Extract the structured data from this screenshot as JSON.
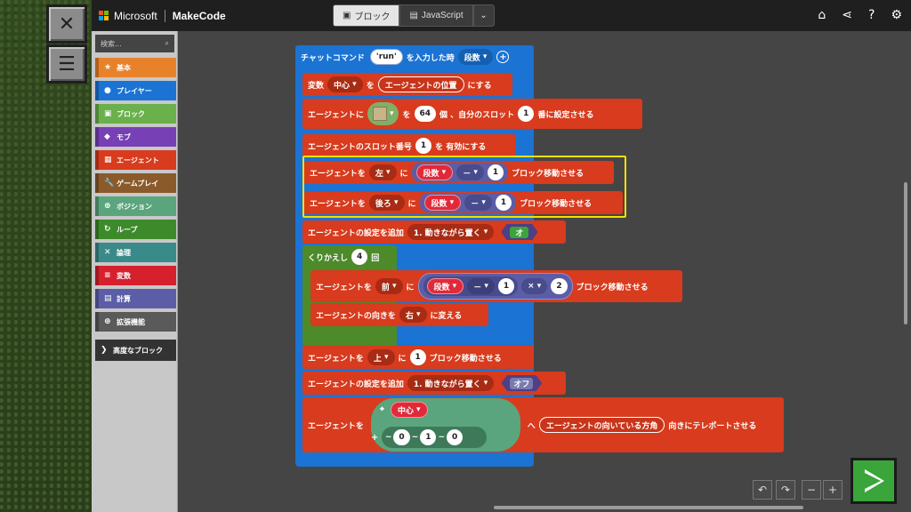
{
  "window": {
    "brand": "Microsoft",
    "product": "MakeCode"
  },
  "tabs": [
    {
      "label": "ブロック",
      "icon": "puzzle-icon",
      "active": true
    },
    {
      "label": "JavaScript",
      "icon": "js-icon",
      "active": false
    }
  ],
  "top_icons": [
    "home-icon",
    "share-icon",
    "help-icon",
    "settings-icon"
  ],
  "toolbox": {
    "search_placeholder": "検索...",
    "categories": [
      {
        "label": "基本",
        "color": "#e8822a"
      },
      {
        "label": "プレイヤー",
        "color": "#1b73d4"
      },
      {
        "label": "ブロック",
        "color": "#6ab04c"
      },
      {
        "label": "モブ",
        "color": "#7740b5"
      },
      {
        "label": "エージェント",
        "color": "#d83b1d"
      },
      {
        "label": "ゲームプレイ",
        "color": "#8b5a2b"
      },
      {
        "label": "ポジション",
        "color": "#5aa57d"
      },
      {
        "label": "ループ",
        "color": "#3d8a2a"
      },
      {
        "label": "論理",
        "color": "#3a8a8a"
      },
      {
        "label": "変数",
        "color": "#d6202e"
      },
      {
        "label": "計算",
        "color": "#5b5ea6"
      },
      {
        "label": "拡張機能",
        "color": "#5a5a5a"
      },
      {
        "label": "高度なブロック",
        "color": "#333333"
      }
    ]
  },
  "blocks": {
    "hat": {
      "text1": "チャットコマンド",
      "cmd": "run",
      "text2": "を入力した時",
      "param": "段数"
    },
    "b1": {
      "t1": "変数",
      "var": "中心",
      "t2": "を",
      "val": "エージェントの位置",
      "t3": "にする"
    },
    "b2": {
      "t1": "エージェントに",
      "count": "64",
      "t2": "個 、自分のスロット",
      "slot": "1",
      "t3": "番に設定させる"
    },
    "b3": {
      "t1": "エージェントのスロット番号",
      "slot": "1",
      "t2": "を 有効にする"
    },
    "b4": {
      "t1": "エージェントを",
      "dir": "左",
      "t2": "に",
      "var": "段数",
      "op": "－",
      "num": "1",
      "t3": "ブロック移動させる"
    },
    "b5": {
      "t1": "エージェントを",
      "dir": "後ろ",
      "t2": "に",
      "var": "段数",
      "op": "－",
      "num": "1",
      "t3": "ブロック移動させる"
    },
    "b6": {
      "t1": "エージェントの設定を追加",
      "opt": "1. 動きながら置く",
      "toggle": "オ"
    },
    "loop": {
      "t1": "くりかえし",
      "n": "4",
      "t2": "回"
    },
    "b7": {
      "t1": "エージェントを",
      "dir": "前",
      "t2": "に",
      "var": "段数",
      "op": "－",
      "num": "1",
      "op2": "×",
      "num2": "2",
      "t3": "ブロック移動させる"
    },
    "b8": {
      "t1": "エージェントの向きを",
      "dir": "右",
      "t2": "に変える"
    },
    "b9": {
      "t1": "エージェントを",
      "dir": "上",
      "t2": "に",
      "num": "1",
      "t3": "ブロック移動させる"
    },
    "b10": {
      "t1": "エージェントの設定を追加",
      "opt": "1. 動きながら置く",
      "toggle": "オフ"
    },
    "b11": {
      "t1": "エージェントを",
      "var": "中心",
      "plus": "+",
      "tilde": "~",
      "x": "0",
      "y": "1",
      "z": "0",
      "t2": "へ",
      "facing": "エージェントの向いている方角",
      "t3": "向きにテレポートさせる"
    }
  },
  "controls": [
    "undo-icon",
    "redo-icon",
    "zoom-out-icon",
    "zoom-in-icon",
    "run-icon"
  ]
}
